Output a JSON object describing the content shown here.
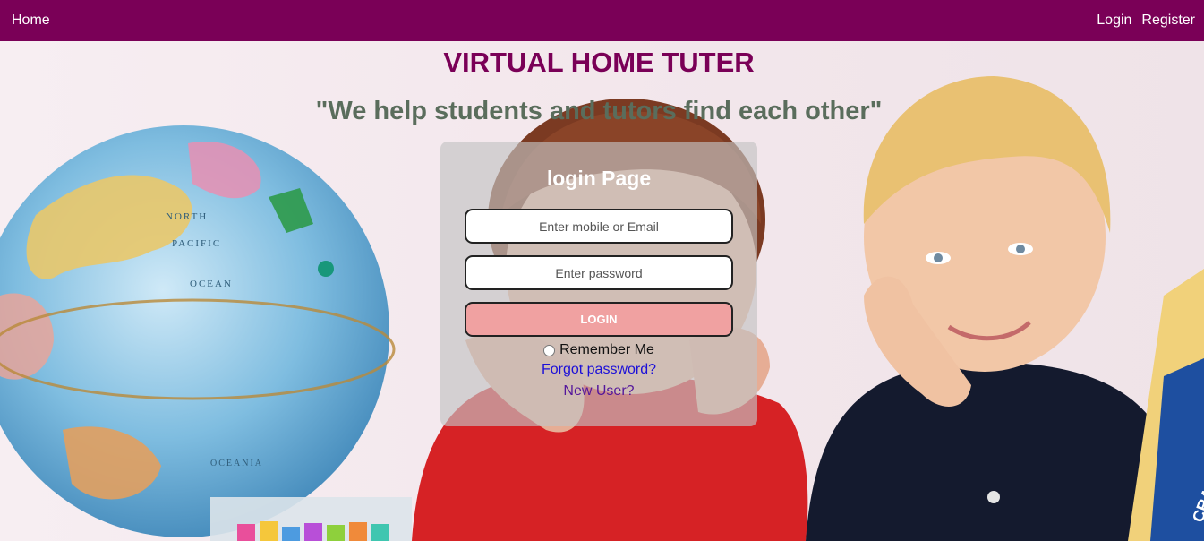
{
  "nav": {
    "home_label": "Home",
    "login_label": "Login",
    "register_label": "Register"
  },
  "header": {
    "title": "VIRTUAL HOME TUTER",
    "tagline": "\"We help students and tutors find each other\""
  },
  "login": {
    "heading": "login Page",
    "email_placeholder": "Enter mobile or Email",
    "password_placeholder": "Enter password",
    "button_label": "LOGIN",
    "remember_label": "Remember Me",
    "forgot_label": "Forgot password?",
    "new_user_label": "New User?"
  },
  "colors": {
    "navbar": "#7a0057",
    "title": "#7a0057",
    "tagline": "#5a6d5c",
    "login_button": "#f0a1a1"
  }
}
